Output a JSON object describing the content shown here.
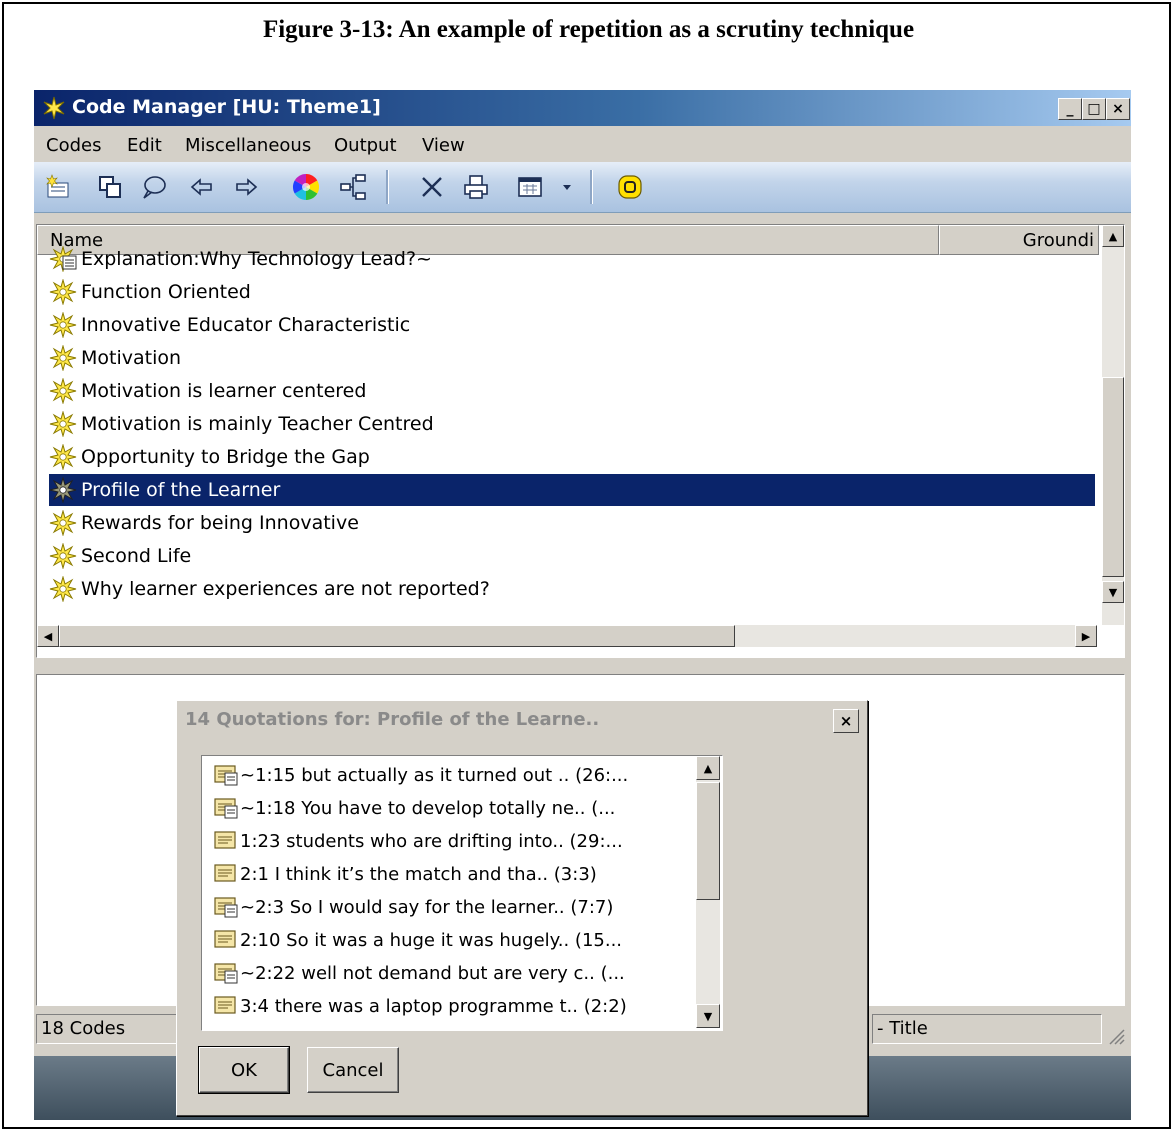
{
  "caption": "Figure 3-13: An example of repetition as a scrutiny technique",
  "window": {
    "title": "Code Manager [HU: Theme1]",
    "min_label": "_",
    "max_label": "□",
    "close_label": "×"
  },
  "menu": [
    "Codes",
    "Edit",
    "Miscellaneous",
    "Output",
    "View"
  ],
  "toolbar": {
    "icons": [
      "new-code-icon",
      "duplicate-icon",
      "comment-icon",
      "back-arrow-icon",
      "forward-arrow-icon",
      "color-wheel-icon",
      "network-icon",
      "delete-icon",
      "print-icon",
      "table-view-icon",
      "dropdown-icon",
      "highlight-icon"
    ]
  },
  "code_list": {
    "columns": [
      "Name",
      "Groundi"
    ],
    "rows": [
      {
        "label": "Explanation:Why Technology Lead?~",
        "icon": "memo-code-icon"
      },
      {
        "label": "Function Oriented",
        "icon": "code-icon"
      },
      {
        "label": "Innovative Educator Characteristic",
        "icon": "code-icon"
      },
      {
        "label": "Motivation",
        "icon": "code-icon"
      },
      {
        "label": "Motivation is learner centered",
        "icon": "code-icon"
      },
      {
        "label": "Motivation is mainly Teacher Centred",
        "icon": "code-icon"
      },
      {
        "label": "Opportunity to Bridge the Gap",
        "icon": "code-icon"
      },
      {
        "label": "Profile of the Learner",
        "icon": "code-icon",
        "selected": true
      },
      {
        "label": "Rewards for being Innovative",
        "icon": "code-icon"
      },
      {
        "label": "Second Life",
        "icon": "code-icon"
      },
      {
        "label": "Why learner experiences are not reported?",
        "icon": "code-icon"
      }
    ]
  },
  "status": {
    "count": "18 Codes",
    "right": "- Title"
  },
  "dialog": {
    "title": "14 Quotations for: Profile of the Learne..",
    "close_label": "×",
    "quotations": [
      {
        "text": "~1:15 but actually as it turned out .. (26:...",
        "icon": "memo-quote-icon"
      },
      {
        "text": "~1:18 You have to develop totally ne.. (...",
        "icon": "memo-quote-icon"
      },
      {
        "text": "1:23 students who are drifting into.. (29:...",
        "icon": "quote-icon"
      },
      {
        "text": "2:1 I think it’s the match and tha.. (3:3)",
        "icon": "quote-icon"
      },
      {
        "text": "~2:3 So I would say for the learner.. (7:7)",
        "icon": "memo-quote-icon"
      },
      {
        "text": "2:10 So it was a huge it was hugely.. (15...",
        "icon": "quote-icon"
      },
      {
        "text": "~2:22 well not demand but are very c.. (...",
        "icon": "memo-quote-icon"
      },
      {
        "text": "3:4 there was a laptop programme t.. (2:2)",
        "icon": "quote-icon"
      }
    ],
    "ok_label": "OK",
    "cancel_label": "Cancel"
  }
}
